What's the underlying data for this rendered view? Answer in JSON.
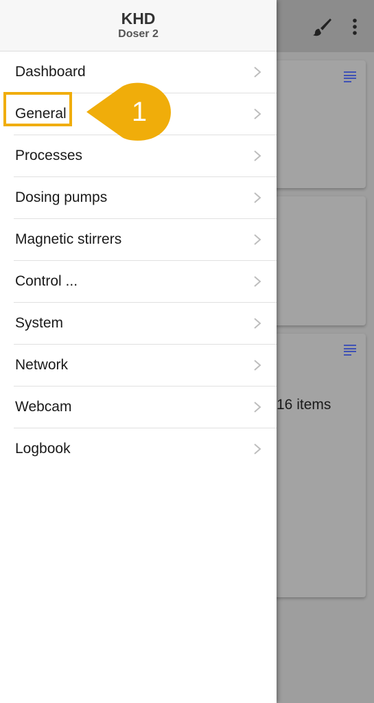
{
  "drawer": {
    "title": "KHD",
    "subtitle": "Doser 2",
    "items": [
      {
        "label": "Dashboard"
      },
      {
        "label": "General"
      },
      {
        "label": "Processes"
      },
      {
        "label": "Dosing pumps"
      },
      {
        "label": "Magnetic stirrers"
      },
      {
        "label": "Control ..."
      },
      {
        "label": "System"
      },
      {
        "label": "Network"
      },
      {
        "label": "Webcam"
      },
      {
        "label": "Logbook"
      }
    ]
  },
  "background": {
    "card3_text": "16 items",
    "icons": [
      "brush-icon",
      "more-vert-icon",
      "list-icon"
    ]
  },
  "annotation": {
    "number": "1",
    "color": "#f0ad0a"
  },
  "colors": {
    "accent": "#3f51b5",
    "scrim_background": "#9e9e9e"
  }
}
